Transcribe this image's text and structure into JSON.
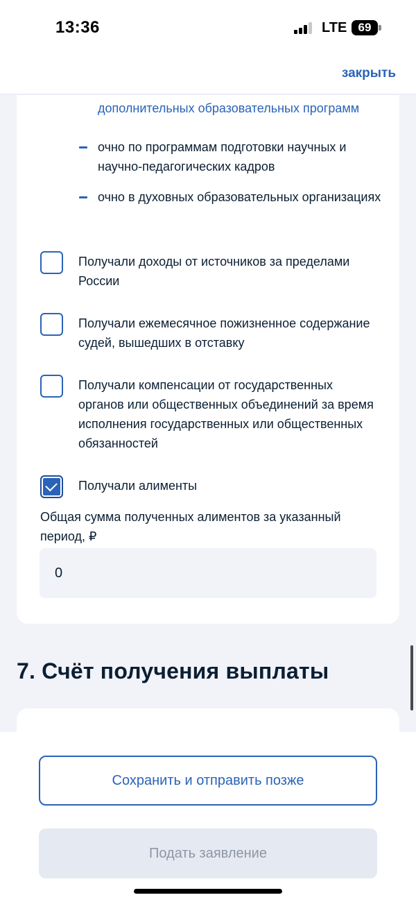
{
  "status_bar": {
    "time": "13:36",
    "network": "LTE",
    "battery": "69"
  },
  "header": {
    "close_label": "закрыть"
  },
  "form": {
    "continued_text": "дополнительных образовательных программ",
    "sub_items": [
      "очно по программам подготовки научных и научно-педагогических кадров",
      "очно в духовных образовательных организациях"
    ],
    "checkboxes": [
      {
        "label": "Получали доходы от источников за пределами России",
        "checked": false
      },
      {
        "label": "Получали ежемесячное пожизненное содержание судей, вышедших в отставку",
        "checked": false
      },
      {
        "label": "Получали компенсации от государственных органов или общественных объединений за время исполнения государственных или общественных обязанностей",
        "checked": false
      },
      {
        "label": "Получали алименты",
        "checked": true
      }
    ],
    "alimony_field": {
      "label": "Общая сумма полученных алиментов за указанный период, ₽",
      "value": "0"
    }
  },
  "section": {
    "title": "7. Счёт получения выплаты"
  },
  "actions": {
    "save_label": "Сохранить и отправить позже",
    "submit_label": "Подать заявление"
  },
  "colors": {
    "accent": "#2a63b8",
    "text": "#0b1f33",
    "page_background": "#f1f3f8",
    "disabled_button": "#e5e9f1"
  }
}
